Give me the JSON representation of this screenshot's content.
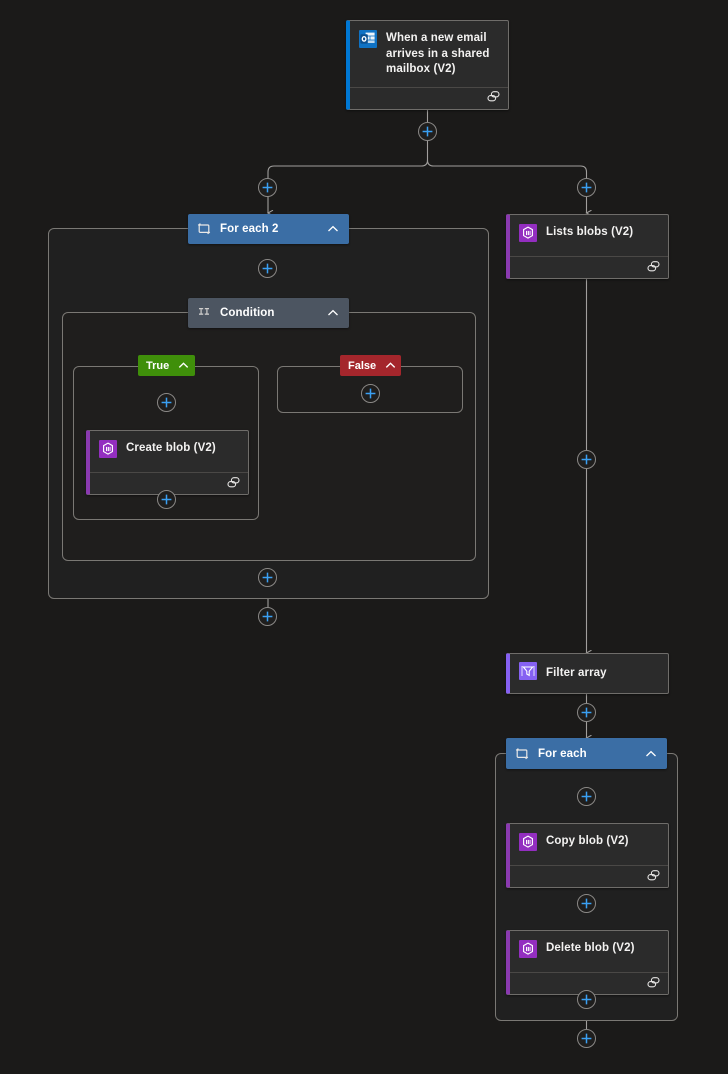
{
  "app": {
    "name": "logic-app-designer",
    "background": "#1b1a19"
  },
  "colors": {
    "trigger_accent": "#0078d4",
    "blob_accent": "#8a3ab0",
    "filter_accent": "#8661f2",
    "foreach_header": "#3b6ea5",
    "condition_header": "#4c5561",
    "true_label": "#3f8f0a",
    "false_label": "#a4262c",
    "plus_glyph": "#3aa0f3",
    "connector": "#a19f9d",
    "scope_border": "#7a7874",
    "card_bg": "#2b2b2b"
  },
  "nodes": {
    "trigger": {
      "title": "When a new email arrives in a shared mailbox (V2)",
      "icon": "outlook-icon",
      "footer_icon": "connection-link-icon",
      "accent": "#0078d4"
    },
    "foreach2": {
      "title": "For each 2",
      "icon": "foreach-loop-icon",
      "chevron": "chevron-up-icon"
    },
    "condition": {
      "title": "Condition",
      "icon": "condition-icon",
      "chevron": "chevron-up-icon"
    },
    "true_branch": {
      "label": "True",
      "chevron": "chevron-up-icon"
    },
    "false_branch": {
      "label": "False",
      "chevron": "chevron-up-icon"
    },
    "create_blob": {
      "title": "Create blob (V2)",
      "icon": "azure-blob-icon",
      "footer_icon": "connection-link-icon",
      "accent": "#8a3ab0"
    },
    "lists_blobs": {
      "title": "Lists blobs (V2)",
      "icon": "azure-blob-icon",
      "footer_icon": "connection-link-icon",
      "accent": "#8a3ab0"
    },
    "filter_array": {
      "title": "Filter array",
      "icon": "filter-array-icon",
      "accent": "#8661f2"
    },
    "foreach": {
      "title": "For each",
      "icon": "foreach-loop-icon",
      "chevron": "chevron-up-icon"
    },
    "copy_blob": {
      "title": "Copy blob (V2)",
      "icon": "azure-blob-icon",
      "footer_icon": "connection-link-icon",
      "accent": "#8a3ab0"
    },
    "delete_blob": {
      "title": "Delete blob (V2)",
      "icon": "azure-blob-icon",
      "footer_icon": "connection-link-icon",
      "accent": "#8a3ab0"
    }
  },
  "add_buttons": [
    {
      "name": "add-step-after-trigger",
      "label": "+"
    },
    {
      "name": "add-step-left-branch",
      "label": "+"
    },
    {
      "name": "add-step-right-branch",
      "label": "+"
    },
    {
      "name": "add-step-in-foreach2",
      "label": "+"
    },
    {
      "name": "add-step-in-true-branch",
      "label": "+"
    },
    {
      "name": "add-step-in-false-branch",
      "label": "+"
    },
    {
      "name": "add-step-after-create-blob",
      "label": "+"
    },
    {
      "name": "add-step-after-condition",
      "label": "+"
    },
    {
      "name": "add-step-after-foreach2",
      "label": "+"
    },
    {
      "name": "add-step-after-lists-blobs",
      "label": "+"
    },
    {
      "name": "add-step-after-filter-array",
      "label": "+"
    },
    {
      "name": "add-step-in-foreach",
      "label": "+"
    },
    {
      "name": "add-step-after-copy-blob",
      "label": "+"
    },
    {
      "name": "add-step-after-delete-blob",
      "label": "+"
    },
    {
      "name": "add-step-after-foreach",
      "label": "+"
    }
  ]
}
